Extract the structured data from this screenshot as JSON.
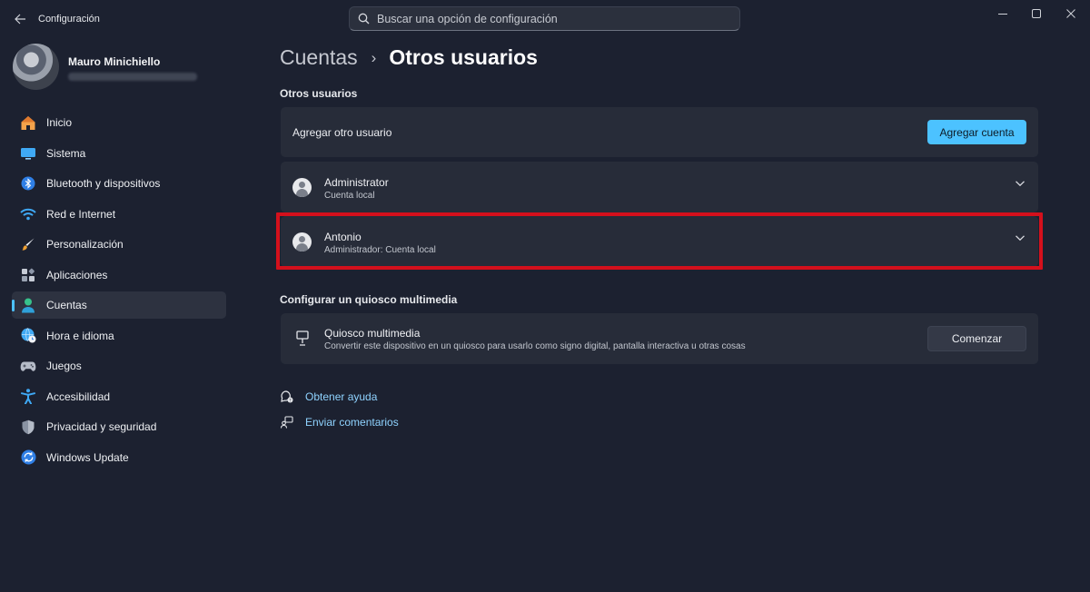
{
  "app": {
    "title": "Configuración",
    "back_icon": "arrow-left-icon"
  },
  "search": {
    "placeholder": "Buscar una opción de configuración",
    "icon": "search-icon"
  },
  "window_controls": [
    "minimize-icon",
    "maximize-icon",
    "close-icon"
  ],
  "profile": {
    "name": "Mauro Minichiello",
    "email": ""
  },
  "sidebar": {
    "items": [
      {
        "label": "Inicio",
        "icon": "home-icon",
        "active": false
      },
      {
        "label": "Sistema",
        "icon": "monitor-icon",
        "active": false
      },
      {
        "label": "Bluetooth y dispositivos",
        "icon": "bluetooth-icon",
        "active": false
      },
      {
        "label": "Red e Internet",
        "icon": "wifi-icon",
        "active": false
      },
      {
        "label": "Personalización",
        "icon": "brush-icon",
        "active": false
      },
      {
        "label": "Aplicaciones",
        "icon": "apps-icon",
        "active": false
      },
      {
        "label": "Cuentas",
        "icon": "person-icon",
        "active": true
      },
      {
        "label": "Hora e idioma",
        "icon": "globe-clock-icon",
        "active": false
      },
      {
        "label": "Juegos",
        "icon": "gamepad-icon",
        "active": false
      },
      {
        "label": "Accesibilidad",
        "icon": "accessibility-icon",
        "active": false
      },
      {
        "label": "Privacidad y seguridad",
        "icon": "shield-icon",
        "active": false
      },
      {
        "label": "Windows Update",
        "icon": "update-icon",
        "active": false
      }
    ]
  },
  "breadcrumb": {
    "parent": "Cuentas",
    "separator": "›",
    "current": "Otros usuarios"
  },
  "other_users": {
    "section_title": "Otros usuarios",
    "add_user_label": "Agregar otro usuario",
    "add_account_button": "Agregar cuenta",
    "users": [
      {
        "name": "Administrator",
        "type": "Cuenta local"
      },
      {
        "name": "Antonio",
        "type": "Administrador: Cuenta local"
      }
    ]
  },
  "kiosk": {
    "section_title": "Configurar un quiosco multimedia",
    "title": "Quiosco multimedia",
    "description": "Convertir este dispositivo en un quiosco para usarlo como signo digital, pantalla interactiva u otras cosas",
    "button": "Comenzar"
  },
  "links": {
    "help": "Obtener ayuda",
    "feedback": "Enviar comentarios"
  },
  "colors": {
    "background": "#1c2130",
    "card": "#272c39",
    "accent": "#4cc2ff",
    "highlight": "#d4101c",
    "link": "#8fd3ff"
  }
}
